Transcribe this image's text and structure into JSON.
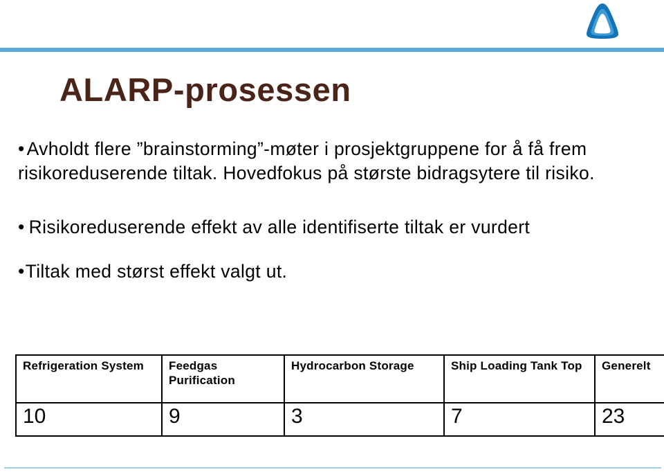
{
  "slide": {
    "title": "ALARP-prosessen",
    "title_color": "#4a2418",
    "accent_color": "#5da9db",
    "accent_color_light": "#9fcde4",
    "logo": {
      "name": "triangle-arch-logo",
      "outer_color": "#1573b8",
      "mid_color": "#3e9ed4",
      "inner_color": "#ffffff"
    }
  },
  "body": {
    "bullets": [
      {
        "marker": "•",
        "text": "Avholdt flere ”brainstorming”-møter i prosjektgruppene for å få frem risikoreduserende tiltak.  Hovedfokus på største bidragsytere til risiko."
      },
      {
        "marker": "•",
        "text": "Risikoreduserende effekt av alle identifiserte tiltak er vurdert"
      },
      {
        "marker": "•",
        "text": "Tiltak med størst effekt valgt ut."
      }
    ]
  },
  "table": {
    "headers": [
      "Refrigeration System",
      "Feedgas Purification",
      "Hydrocarbon Storage",
      "Ship Loading Tank Top",
      "Generelt"
    ],
    "values": [
      "10",
      "9",
      "3",
      "7",
      "23"
    ]
  }
}
